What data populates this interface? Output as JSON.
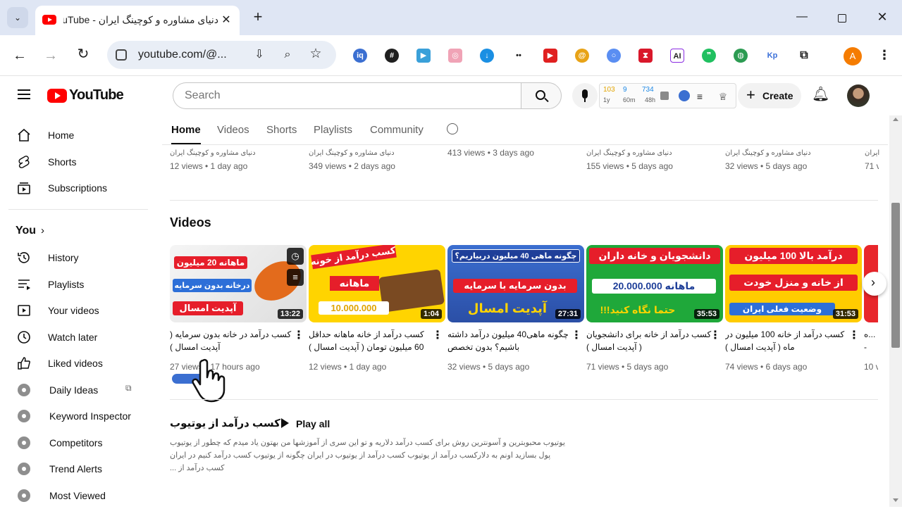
{
  "browser": {
    "tab_title": "دنیای مشاوره و کوچینگ ایران - YouTube",
    "url": "youtube.com/@...",
    "profile_initial": "A",
    "accent": "#dfe6f4"
  },
  "youtube": {
    "logo_text": "YouTube",
    "search_placeholder": "Search",
    "create_label": "Create",
    "widget": {
      "stat1_value": "103",
      "stat1_label": "1y",
      "stat2_value": "9",
      "stat2_label": "60m",
      "stat3_value": "734",
      "stat3_label": "48h"
    }
  },
  "sidebar": {
    "items": [
      {
        "label": "Home",
        "icon": "home-icon"
      },
      {
        "label": "Shorts",
        "icon": "shorts-icon"
      },
      {
        "label": "Subscriptions",
        "icon": "subscriptions-icon"
      }
    ],
    "you_label": "You",
    "you_items": [
      {
        "label": "History",
        "icon": "history-icon"
      },
      {
        "label": "Playlists",
        "icon": "playlists-icon"
      },
      {
        "label": "Your videos",
        "icon": "your-videos-icon"
      },
      {
        "label": "Watch later",
        "icon": "watch-later-icon"
      },
      {
        "label": "Liked videos",
        "icon": "liked-icon"
      }
    ],
    "ext_items": [
      {
        "label": "Daily Ideas",
        "icon": "extension-icon"
      },
      {
        "label": "Keyword Inspector",
        "icon": "extension-icon"
      },
      {
        "label": "Competitors",
        "icon": "extension-icon"
      },
      {
        "label": "Trend Alerts",
        "icon": "extension-icon"
      },
      {
        "label": "Most Viewed",
        "icon": "extension-icon"
      }
    ]
  },
  "channel_tabs": [
    "Home",
    "Videos",
    "Shorts",
    "Playlists",
    "Community"
  ],
  "shorts_row": [
    {
      "channel": "دنیای مشاوره و کوچینگ ایران",
      "stats": "12 views • 1 day ago"
    },
    {
      "channel": "دنیای مشاوره و کوچینگ ایران",
      "stats": "349 views • 2 days ago"
    },
    {
      "channel": "",
      "stats": "413 views • 3 days ago"
    },
    {
      "channel": "دنیای مشاوره و کوچینگ ایران",
      "stats": "155 views • 5 days ago"
    },
    {
      "channel": "دنیای مشاوره و کوچینگ ایران",
      "stats": "32 views • 5 days ago"
    },
    {
      "channel": "ایران",
      "stats": "71 v"
    }
  ],
  "videos_section": {
    "heading": "Videos",
    "videos": [
      {
        "title": "کسب درآمد در خانه بدون سرمایه ( آپدیت امسال )",
        "stats": "27 views • 17 hours ago",
        "duration": "13:22",
        "thumb_top": "ماهانه 20 میلیون",
        "thumb_mid": "درخانه بدون سرمایه",
        "thumb_bottom": "آپدیت امسال",
        "color": "#f3f3f3"
      },
      {
        "title": "کسب درآمد از خانه ماهانه حداقل 60 میلیون تومان ( آپدیت امسال )",
        "stats": "12 views • 1 day ago",
        "duration": "1:04",
        "thumb_top": "کسب درآمد از خونه",
        "thumb_mid": "ماهانه",
        "thumb_bottom": "10.000.000",
        "color": "#ffd400"
      },
      {
        "title": "چگونه ماهی40 میلیون درآمد داشته باشیم؟ بدون تخصص",
        "stats": "32 views • 5 days ago",
        "duration": "27:31",
        "thumb_top": "چگونه ماهی 40 میلیون دربیاریم؟",
        "thumb_mid": "بدون سرمایه  با سرمایه",
        "thumb_bottom": "آپدیت امسال",
        "color": "#3d6ec9"
      },
      {
        "title": "کسب درآمد از خانه برای دانشجویان ( آپدیت امسال )",
        "stats": "71 views • 5 days ago",
        "duration": "35:53",
        "thumb_top": "دانشجویان و خانه داران",
        "thumb_mid": "ماهانه 20.000.000",
        "thumb_bottom": "حتما نگاه کنید!!!",
        "color": "#1fa83a"
      },
      {
        "title": "کسب درآمد از خانه 100 میلیون در ماه ( آپدیت امسال )",
        "stats": "74 views • 6 days ago",
        "duration": "31:53",
        "thumb_top": "درآمد بالا 100 میلیون",
        "thumb_mid": "از خانه و منزل خودت",
        "thumb_bottom": "وضعیت فعلی ایران",
        "color": "#ffcc00"
      },
      {
        "title": "...ه - آمد",
        "stats": "10 v",
        "duration": "",
        "thumb_top": "",
        "thumb_mid": "",
        "thumb_bottom": "",
        "color": "#e8262b"
      }
    ]
  },
  "playlist_section": {
    "title": "کسب درآمد از یوتیوب",
    "play_all": "Play all",
    "description": "یوتیوب محبوبترین و آسونترین روش برای کسب درآمد دلاریه و تو این سری از آموزشها من بهتون یاد میدم که چطور از یوتیوب پول بسازید اونم به دلارکسب درآمد از یوتیوب کسب درآمد از یوتیوب در ایران چگونه از یوتیوب کسب درآمد کنیم در ایران کسب درآمد از ..."
  }
}
